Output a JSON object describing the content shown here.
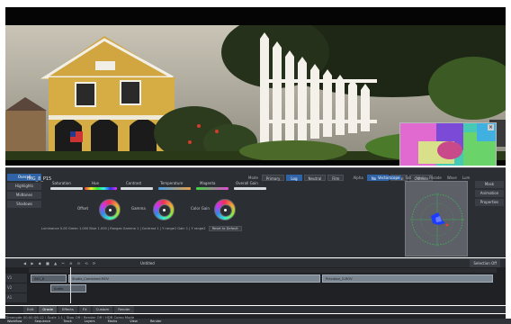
{
  "panel": {
    "left_tabs": [
      "Overall",
      "Highlights",
      "Midtones",
      "Shadows"
    ],
    "clip_name": "IMG_8_P15",
    "mode_label": "Mode",
    "modes": [
      "Primary",
      "Log",
      "Neutral",
      "Film"
    ],
    "active_mode": "Log",
    "alpha_label": "Alpha",
    "alpha_modes": [
      "Normal",
      "Dual",
      "Outside"
    ],
    "sliders": [
      {
        "label": "Saturation",
        "color": "#d6dbe0"
      },
      {
        "label": "Hue",
        "color": "#d6dbe0"
      },
      {
        "label": "Contrast",
        "color": "#d6dbe0"
      },
      {
        "label": "Temperature",
        "color": "#4aa0e6"
      },
      {
        "label": "Magenta",
        "color": "#e14bd2"
      },
      {
        "label": "Overall Gain",
        "color": "#d6dbe0"
      }
    ],
    "wheels": [
      {
        "label": "Offset"
      },
      {
        "label": "Gamma"
      },
      {
        "label": "Color Gain"
      }
    ],
    "readout": {
      "text": "Luminance  0.00   Green  1.000   Blue  1.000  |  Ranges   Gamma   1  |  Contrast  1  |  Y range1  Gain  1  |  Y range2",
      "reset_label": "Reset to Default"
    },
    "scope_header": [
      "Vectorscope",
      "Sat",
      "Hue",
      "Parade",
      "Wave",
      "Lum"
    ],
    "scope_active": "Vectorscope",
    "right_tabs": [
      "Mask",
      "Animation",
      "Properties"
    ]
  },
  "timeline": {
    "sequence_name": "Untitled",
    "tools": "◀ ▶ ◆ ■ ▲ ✂ ⊕ ⊖ ⟲ ⟳",
    "zoom_label": "Selection Off",
    "tracks": [
      "V1",
      "V2",
      "A1"
    ],
    "clips": [
      {
        "label": "IMG_8",
        "track": 0
      },
      {
        "label": "Studio_Combined.MOV",
        "track": 0
      },
      {
        "label": "Precision_2.MOV",
        "track": 0
      },
      {
        "label": "Audio",
        "track": 1
      }
    ]
  },
  "tabs": [
    "Edit",
    "Grade",
    "Effects",
    "FX",
    "Custom",
    "Render"
  ],
  "active_tab": "Grade",
  "status": "Timecode 00:00:06:12   |   Scale 1:1   |   Stop Off   |   Render Off   |   HDR Comp Mode",
  "menu": [
    "Workflow",
    "Sequence",
    "Track",
    "Layers",
    "Marks",
    "View",
    "Render"
  ]
}
